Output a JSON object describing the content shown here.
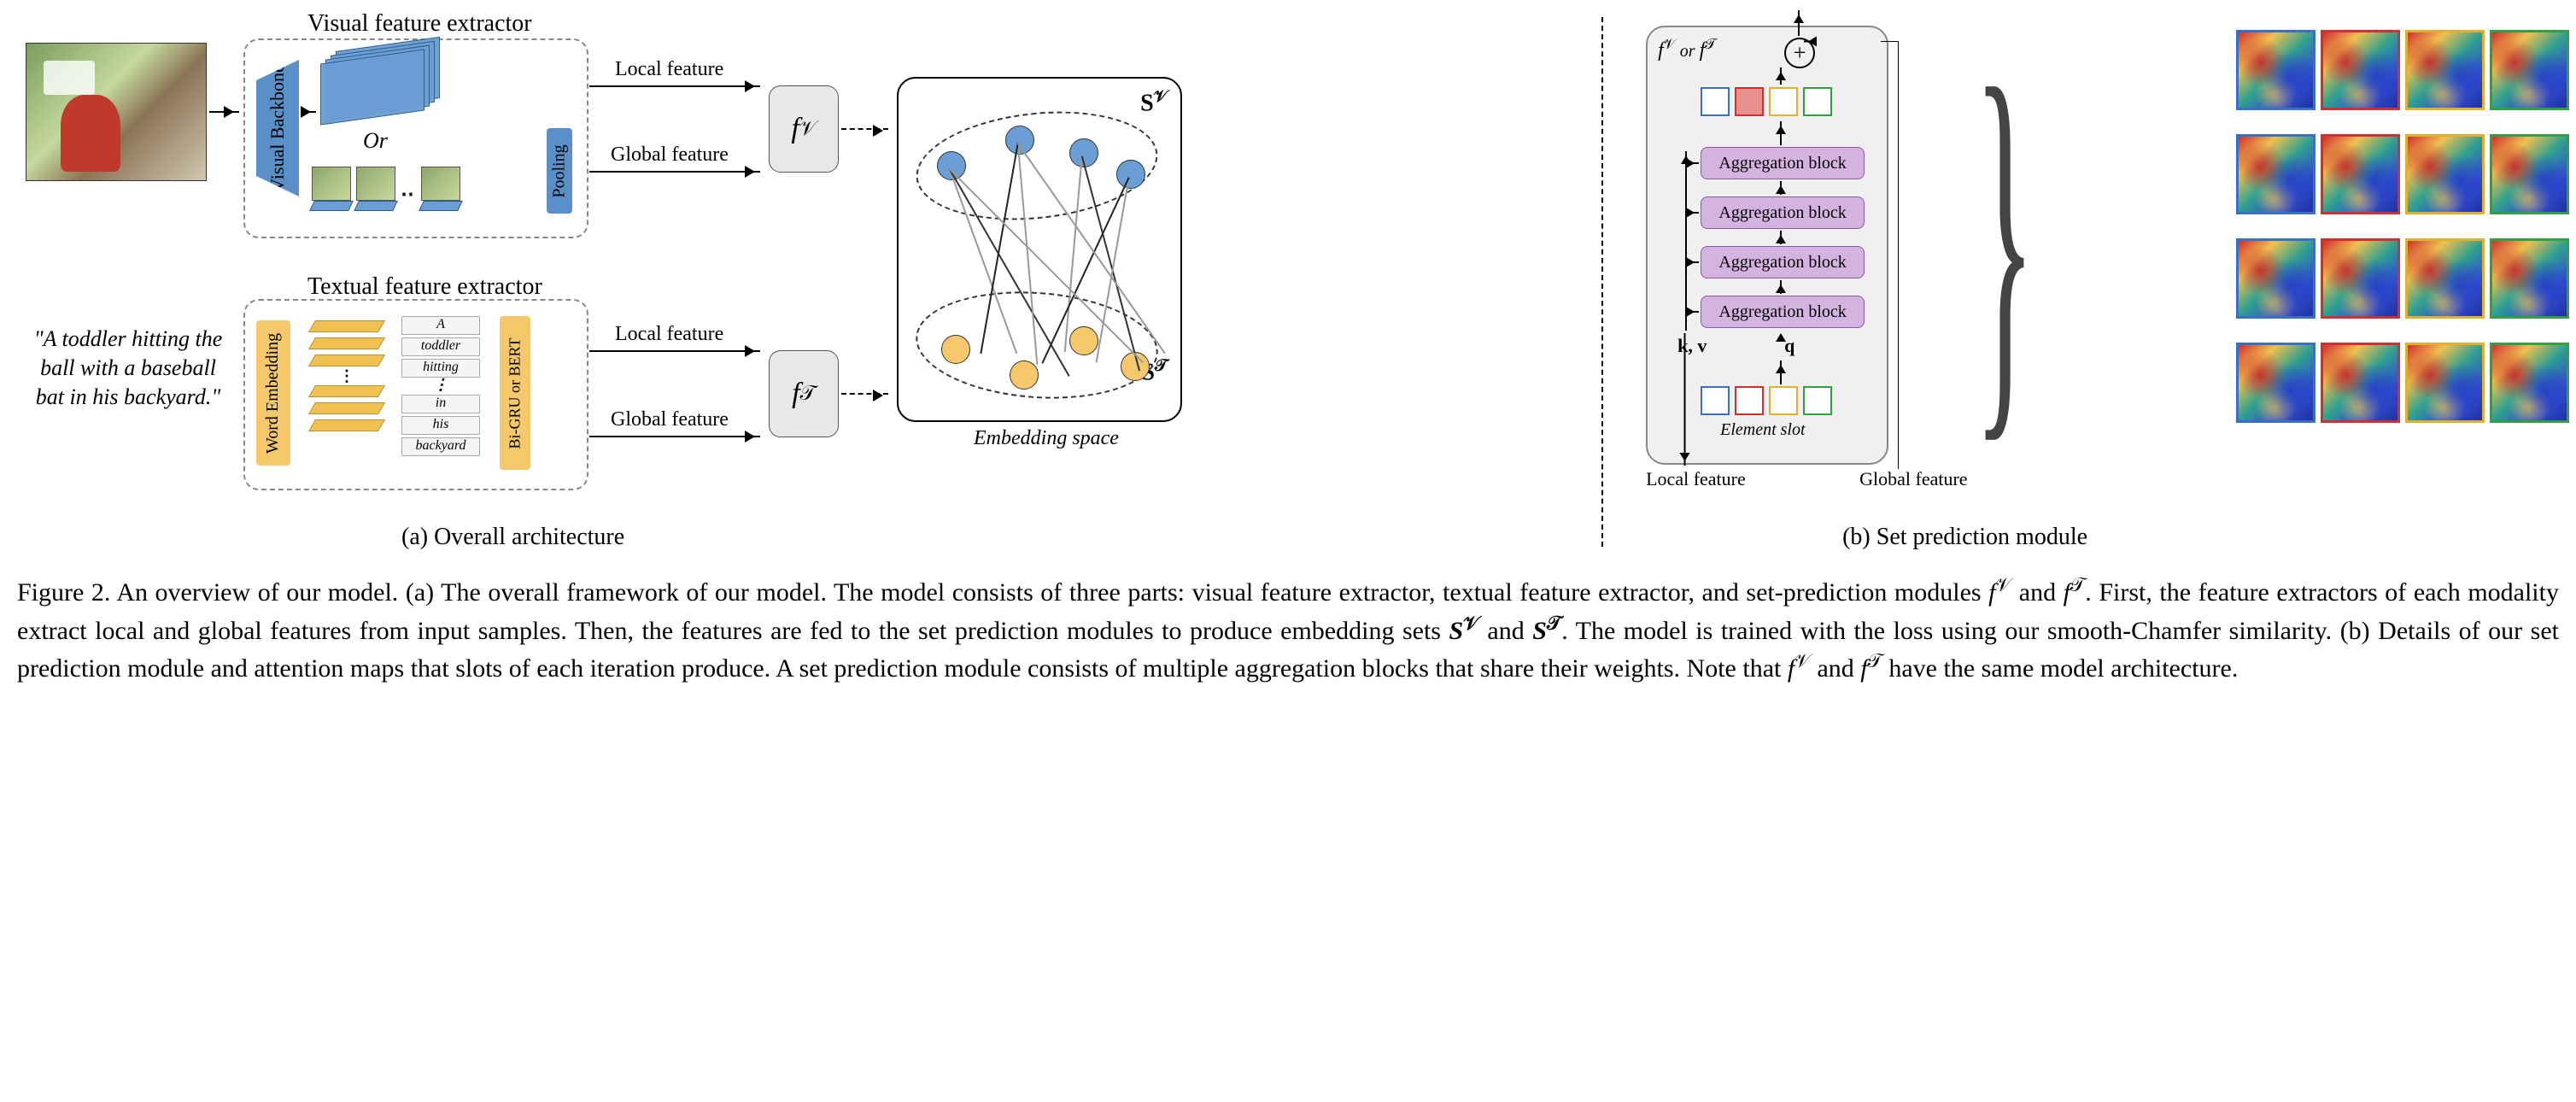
{
  "figure": {
    "number": "Figure 2.",
    "title": "An overview of our model.",
    "caption_a": "(a) The overall framework of our model. The model consists of three parts: visual feature extractor, textual feature extractor, and set-prediction modules ",
    "caption_a2": ". First, the feature extractors of each modality extract local and global features from input samples. Then, the features are fed to the set prediction modules to produce embedding sets ",
    "caption_a3": ". The model is trained with the loss using our smooth-Chamfer similarity. (b) Details of our set prediction module and attention maps that slots of each iteration produce. A set prediction module consists of multiple aggregation blocks that share their weights. Note that ",
    "caption_a4": " have the same model architecture."
  },
  "panel_a": {
    "subcaption": "(a) Overall architecture",
    "visual_extractor_label": "Visual feature extractor",
    "textual_extractor_label": "Textual feature extractor",
    "visual_backbone": "Visual Backbone",
    "pooling": "Pooling",
    "or": "Or",
    "word_embedding": "Word Embedding",
    "bigru": "Bi-GRU or BERT",
    "local_feature": "Local feature",
    "global_feature": "Global feature",
    "input_caption": "\"A toddler hitting the ball with a baseball bat in his backyard.\"",
    "words": [
      "A",
      "toddler",
      "hitting",
      "in",
      "his",
      "backyard"
    ],
    "fv": "f",
    "fv_sup": "𝒱",
    "ft": "f",
    "ft_sup": "𝒯",
    "sv": "S",
    "sv_sup": "𝒱",
    "st": "S",
    "st_sup": "𝒯",
    "embedding_space": "Embedding space"
  },
  "panel_b": {
    "subcaption": "(b) Set prediction module",
    "header": "f",
    "header_sup1": "𝒱",
    "header_or": " or ",
    "header_sup2": "𝒯",
    "agg_block": "Aggregation block",
    "element_slot": "Element slot",
    "k": "k",
    "v": "v",
    "q": "q",
    "local_feature": "Local feature",
    "global_feature": "Global feature"
  },
  "math": {
    "fv": "f",
    "fv_sup": "𝒱",
    "ft": "f",
    "ft_sup": "𝒯",
    "sv": "S",
    "sv_sup": "𝒱",
    "st": "S",
    "st_sup": "𝒯",
    "and": " and "
  }
}
